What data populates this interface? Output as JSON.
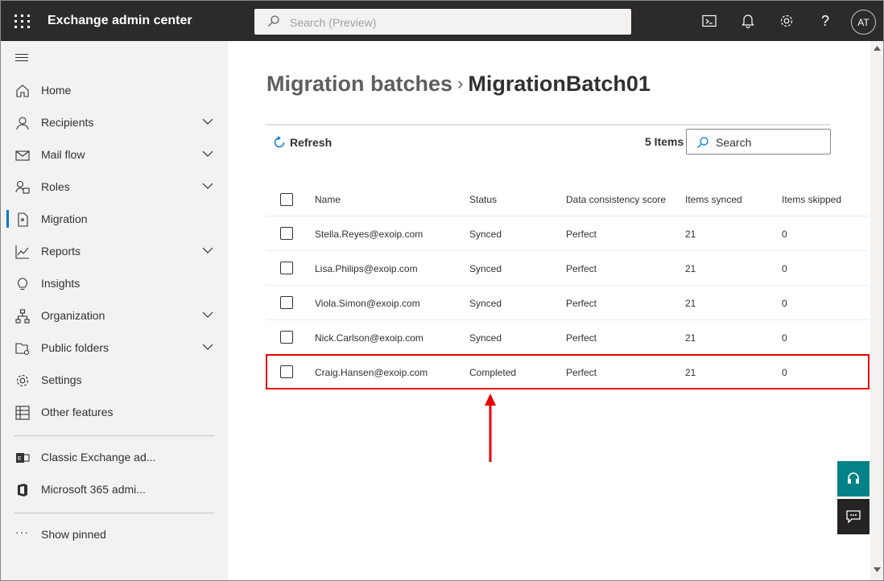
{
  "app": {
    "title": "Exchange admin center"
  },
  "topbar": {
    "search_placeholder": "Search (Preview)",
    "avatar_initials": "AT",
    "icons": [
      "waffle-icon",
      "search-icon",
      "cloud-shell-icon",
      "bell-icon",
      "gear-icon",
      "help-icon"
    ]
  },
  "sidebar": {
    "items": [
      {
        "label": "Home",
        "icon": "home-icon",
        "chevron": false,
        "selected": false
      },
      {
        "label": "Recipients",
        "icon": "person-icon",
        "chevron": true,
        "selected": false
      },
      {
        "label": "Mail flow",
        "icon": "mail-icon",
        "chevron": true,
        "selected": false
      },
      {
        "label": "Roles",
        "icon": "roles-icon",
        "chevron": true,
        "selected": false
      },
      {
        "label": "Migration",
        "icon": "migration-icon",
        "chevron": false,
        "selected": true
      },
      {
        "label": "Reports",
        "icon": "chart-icon",
        "chevron": true,
        "selected": false
      },
      {
        "label": "Insights",
        "icon": "lightbulb-icon",
        "chevron": false,
        "selected": false
      },
      {
        "label": "Organization",
        "icon": "org-icon",
        "chevron": true,
        "selected": false
      },
      {
        "label": "Public folders",
        "icon": "folder-icon",
        "chevron": true,
        "selected": false
      },
      {
        "label": "Settings",
        "icon": "gear-icon",
        "chevron": false,
        "selected": false
      },
      {
        "label": "Other features",
        "icon": "table-icon",
        "chevron": false,
        "selected": false
      }
    ],
    "links": [
      {
        "label": "Classic Exchange ad...",
        "icon": "exchange-icon"
      },
      {
        "label": "Microsoft 365 admi...",
        "icon": "office-icon"
      }
    ],
    "show_pinned": "Show pinned"
  },
  "main": {
    "breadcrumb": {
      "parent": "Migration batches",
      "separator": "›",
      "current": "MigrationBatch01"
    },
    "toolbar": {
      "refresh_label": "Refresh",
      "count": "5 Items",
      "search_label": "Search"
    },
    "table": {
      "headers": [
        "Name",
        "Status",
        "Data consistency score",
        "Items synced",
        "Items skipped"
      ],
      "rows": [
        {
          "name": "Stella.Reyes@exoip.com",
          "status": "Synced",
          "score": "Perfect",
          "synced": "21",
          "skipped": "0"
        },
        {
          "name": "Lisa.Philips@exoip.com",
          "status": "Synced",
          "score": "Perfect",
          "synced": "21",
          "skipped": "0"
        },
        {
          "name": "Viola.Simon@exoip.com",
          "status": "Synced",
          "score": "Perfect",
          "synced": "21",
          "skipped": "0"
        },
        {
          "name": "Nick.Carlson@exoip.com",
          "status": "Synced",
          "score": "Perfect",
          "synced": "21",
          "skipped": "0"
        },
        {
          "name": "Craig.Hansen@exoip.com",
          "status": "Completed",
          "score": "Perfect",
          "synced": "21",
          "skipped": "0"
        }
      ]
    }
  },
  "colors": {
    "topbar": "#2b2b2b",
    "accent": "#0078d4",
    "highlight": "#e60000",
    "fab_teal": "#038387"
  }
}
